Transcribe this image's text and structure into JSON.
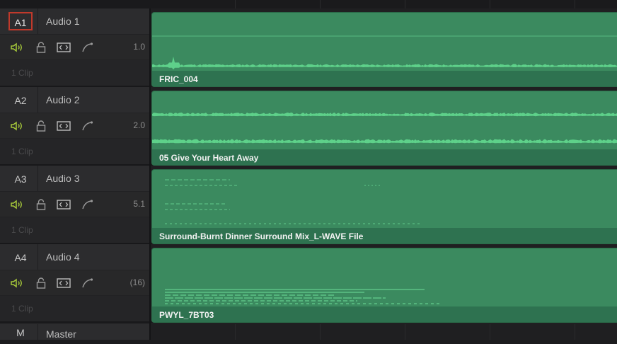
{
  "colors": {
    "clip_fill": "#3b8a5f",
    "waveform": "#5ed18a",
    "speaker_icon": "#a6c83a",
    "selected_border": "#c0392b"
  },
  "tracks": [
    {
      "id": "A1",
      "name": "Audio 1",
      "format": "1.0",
      "clip_count": "1 Clip",
      "clip_name": "FRIC_004",
      "selected": true
    },
    {
      "id": "A2",
      "name": "Audio 2",
      "format": "2.0",
      "clip_count": "1 Clip",
      "clip_name": "05 Give Your Heart Away",
      "selected": false
    },
    {
      "id": "A3",
      "name": "Audio 3",
      "format": "5.1",
      "clip_count": "1 Clip",
      "clip_name": "Surround-Burnt Dinner Surround Mix_L-WAVE File",
      "selected": false
    },
    {
      "id": "A4",
      "name": "Audio 4",
      "format": "(16)",
      "clip_count": "1 Clip",
      "clip_name": "PWYL_7BT03",
      "selected": false
    }
  ],
  "master": {
    "id": "M",
    "name": "Master"
  },
  "icons": [
    "speaker-icon",
    "lock-icon",
    "auto-select-icon",
    "curve-icon"
  ]
}
